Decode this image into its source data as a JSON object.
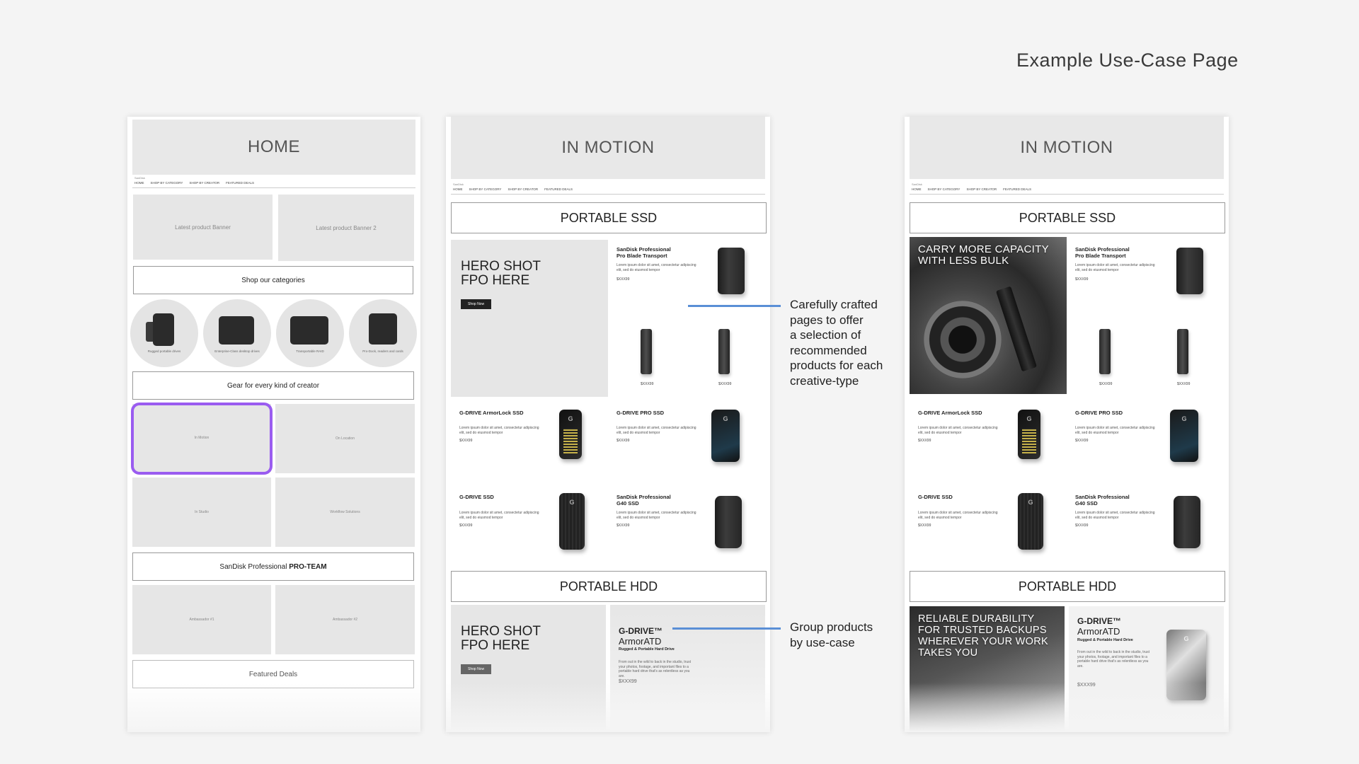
{
  "page_title": "Example Use-Case Page",
  "nav": {
    "logo": "SanDisk",
    "items": [
      "HOME",
      "SHOP BY CATEGORY",
      "SHOP BY CREATOR",
      "FEATURED DEALS"
    ]
  },
  "home": {
    "header": "HOME",
    "banners": [
      "Latest product Banner",
      "Latest product Banner 2"
    ],
    "categories_title": "Shop our categories",
    "categories": [
      "Rugged portable drives",
      "Enterprise-Class desktop drives",
      "Transportable RAID",
      "Pro-Dock, readers and cards"
    ],
    "creator_title": "Gear for every kind of creator",
    "creators": [
      "In Motion",
      "On Location",
      "In Studio",
      "Workflow Solutions"
    ],
    "proteam_prefix": "SanDisk Professional ",
    "proteam_bold": "PRO-TEAM",
    "ambassadors": [
      "Ambassador #1",
      "Ambassador #2"
    ],
    "featured": "Featured Deals"
  },
  "motion": {
    "header": "IN MOTION",
    "ssd_title": "PORTABLE SSD",
    "hdd_title": "PORTABLE HDD",
    "hero_text": "HERO SHOT\nFPO HERE",
    "shop_now": "Shop Now",
    "photo_ssd": "CARRY MORE CAPACITY\nWITH LESS BULK",
    "photo_hdd": "RELIABLE DURABILITY\nFOR TRUSTED BACKUPS\nWHEREVER YOUR WORK\nTAKES YOU",
    "lorem": "Lorem ipsum dolor sit amet, consectetur adipiscing elit, sed do eiusmod tempor",
    "price": "$XXX99",
    "products": [
      {
        "name": "SanDisk Professional\nPro Blade Transport"
      },
      {
        "name": "G-DRIVE ArmorLock SSD"
      },
      {
        "name": "G-DRIVE PRO SSD"
      },
      {
        "name": "G-DRIVE SSD"
      },
      {
        "name": "SanDisk Professional\nG40 SSD"
      }
    ],
    "armoratd": {
      "t1": "G-DRIVE™",
      "t2": "ArmorATD",
      "t3": "Rugged & Portable Hard Drive",
      "desc": "From out in the wild to back in the studio, trust your photos, footage, and important files to a portable hard drive that's as relentless as you are.",
      "price": "$XXX99"
    }
  },
  "callouts": {
    "c1": "Carefully crafted\npages to offer\na selection of\nrecommended\nproducts for each\ncreative-type",
    "c2": "Group products\nby use-case"
  },
  "colors": {
    "highlight": "#9a5cf0",
    "callout_line": "#5a8fd6"
  }
}
